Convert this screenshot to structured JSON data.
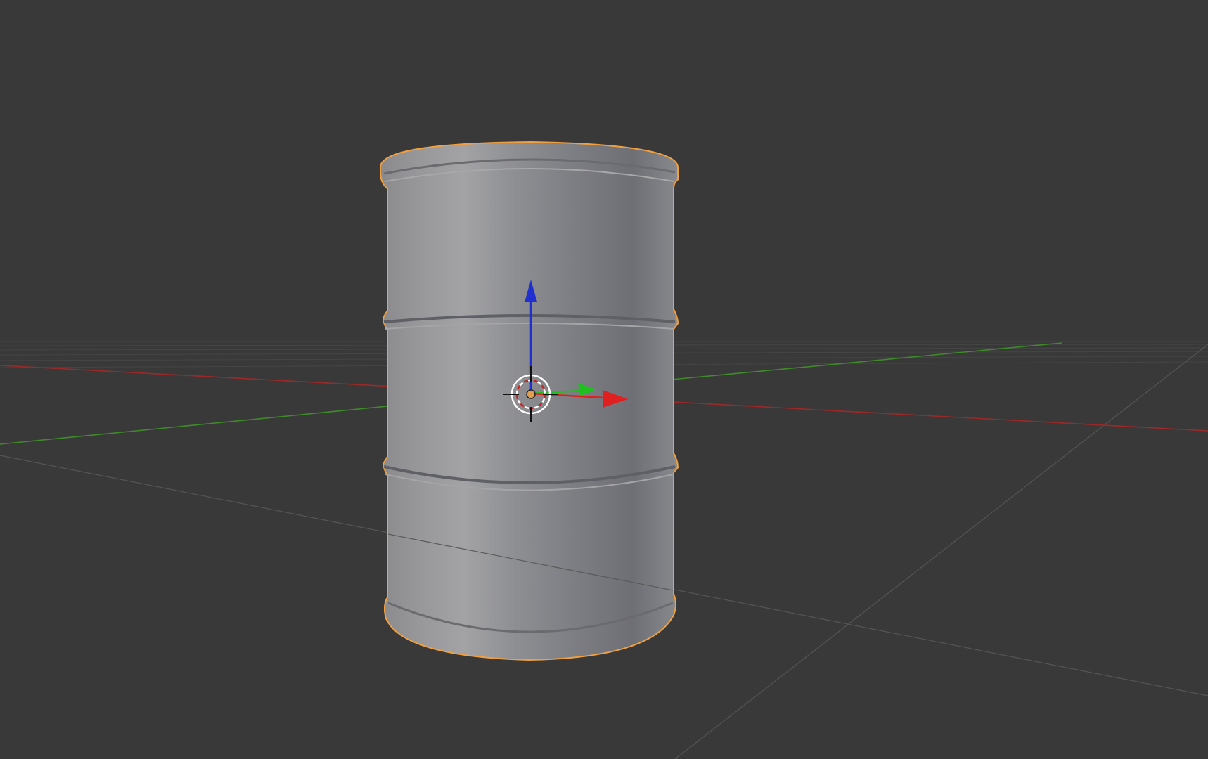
{
  "viewport": {
    "editor": "3d-viewport",
    "background_color": "#393939"
  },
  "grid": {
    "line_color": "#4a4a4a",
    "x_axis_color": "#9a2a2a",
    "y_axis_color": "#3f8a2a"
  },
  "selected_object": {
    "type": "cylinder-barrel",
    "outline_color": "#f0a040",
    "body_color": "#8c8d92",
    "selected": true
  },
  "gizmo": {
    "mode": "translate",
    "x_color": "#e02020",
    "y_color": "#20c020",
    "z_color": "#2030d0"
  },
  "cursor_3d": {
    "icon": "3d-cursor-icon",
    "ring_primary": "#ffffff",
    "ring_secondary": "#d02020"
  },
  "origin": {
    "icon": "object-origin-icon",
    "color": "#e0a050"
  }
}
